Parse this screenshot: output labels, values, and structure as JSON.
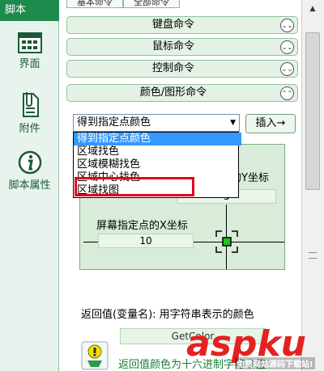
{
  "sidebar": {
    "title": "脚本",
    "items": [
      {
        "label": "界面",
        "icon": "grid-icon"
      },
      {
        "label": "附件",
        "icon": "paperclip-document-icon"
      },
      {
        "label": "脚本属性",
        "icon": "info-icon"
      }
    ]
  },
  "tabs": [
    "基本命令",
    "全部命令"
  ],
  "sections": [
    {
      "label": "键盘命令",
      "state": "collapsed"
    },
    {
      "label": "鼠标命令",
      "state": "collapsed"
    },
    {
      "label": "控制命令",
      "state": "collapsed"
    },
    {
      "label": "颜色/图形命令",
      "state": "expanded"
    }
  ],
  "command_select": {
    "value": "得到指定点颜色",
    "options": [
      "得到指定点颜色",
      "区域找色",
      "区域模糊找色",
      "区域中心找色",
      "区域找图"
    ],
    "highlighted_index": 0,
    "annotated_index": 4
  },
  "insert_button": "插入→",
  "panel": {
    "y_label": "的Y坐标",
    "y_value": "5",
    "x_label": "屏幕指定点的X坐标",
    "x_value": "10"
  },
  "return_label": "返回值(变量名): 用字符串表示的颜色",
  "return_var": "GetColor",
  "tip_text": "返回值颜色为十六进制字符串值",
  "watermark": {
    "part1": "asp",
    "part2": "ku",
    "sub": "免费网站源码下载站!"
  },
  "colors": {
    "sidebar_accent": "#1e8a4c",
    "panel_bg": "#d9ecd9",
    "highlight": "#3399ff",
    "annotation": "#e3001b"
  }
}
